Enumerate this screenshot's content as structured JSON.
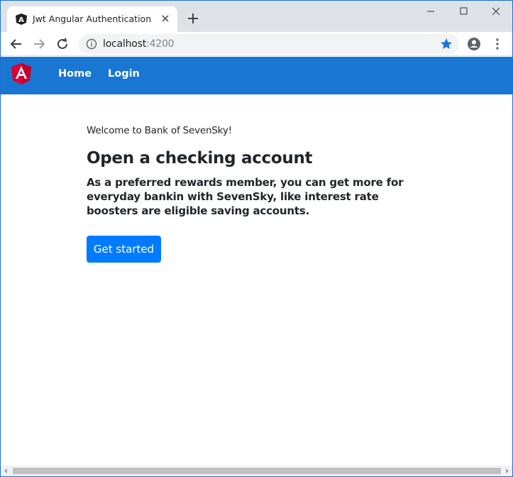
{
  "browser": {
    "tab": {
      "title": "Jwt Angular Authentication",
      "favicon": "angular-icon"
    },
    "address_bar": {
      "host": "localhost",
      "port": ":4200"
    },
    "icons": {
      "back": "back-arrow-icon",
      "forward": "forward-arrow-icon",
      "reload": "reload-icon",
      "info": "info-icon",
      "star": "star-icon",
      "profile": "profile-icon",
      "menu": "kebab-menu-icon",
      "new_tab": "plus-icon",
      "close_tab": "close-icon"
    },
    "colors": {
      "star": "#1a73e8",
      "tabstrip": "#dee1e6"
    }
  },
  "app": {
    "navbar": {
      "links": [
        {
          "label": "Home"
        },
        {
          "label": "Login"
        }
      ],
      "background": "#1976d2"
    },
    "main": {
      "welcome": "Welcome to Bank of SevenSky!",
      "headline": "Open a checking account",
      "lead": "As a preferred rewards member, you can get more for everyday bankin with SevenSky, like interest rate boosters are eligible saving accounts.",
      "cta_label": "Get started",
      "cta_color": "#007bff"
    }
  }
}
